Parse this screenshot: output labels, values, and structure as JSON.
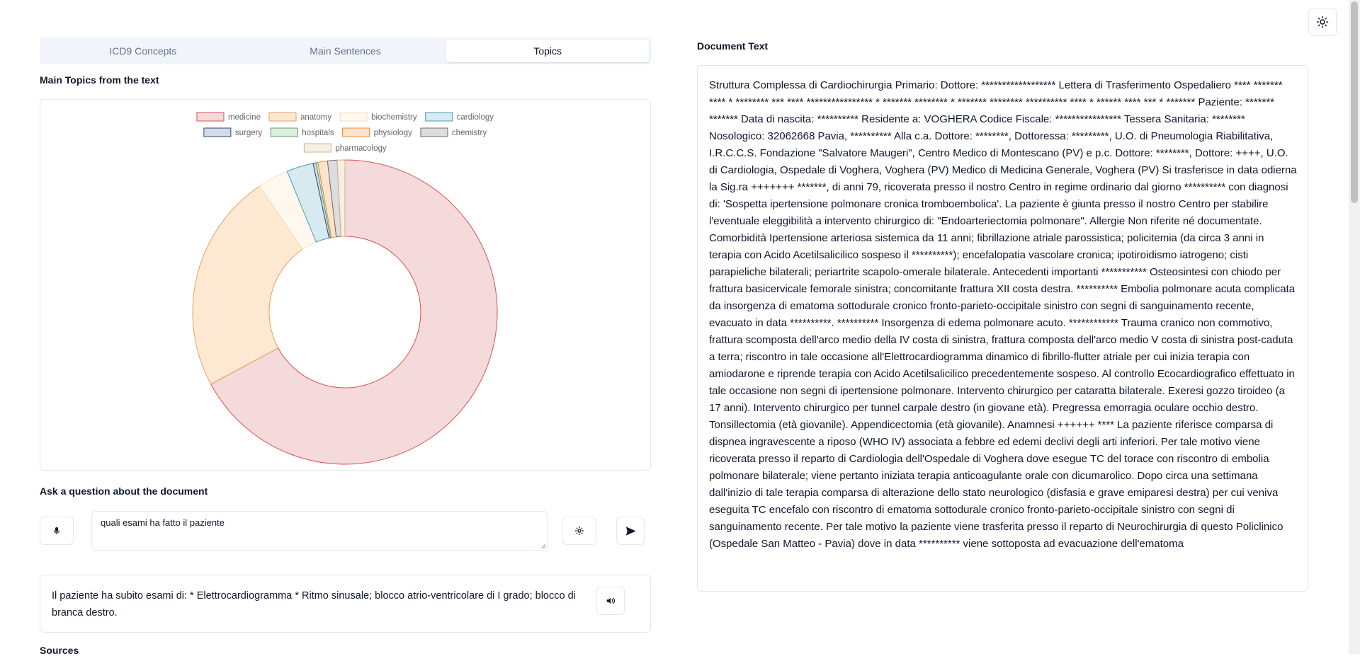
{
  "tabs": [
    {
      "label": "ICD9 Concepts",
      "active": false
    },
    {
      "label": "Main Sentences",
      "active": false
    },
    {
      "label": "Topics",
      "active": true
    }
  ],
  "topics_section": {
    "title": "Main Topics from the text"
  },
  "chart_data": {
    "type": "pie",
    "donut": true,
    "legend_position": "top",
    "series": [
      {
        "name": "medicine",
        "value": 66.0,
        "fill": "#f4dadb",
        "stroke": "#d9534f"
      },
      {
        "name": "anatomy",
        "value": 23.0,
        "fill": "#fde9d2",
        "stroke": "#e8a05c"
      },
      {
        "name": "biochemistry",
        "value": 3.2,
        "fill": "#fff8ee",
        "stroke": "#f3e0c8"
      },
      {
        "name": "cardiology",
        "value": 2.8,
        "fill": "#d6eaf0",
        "stroke": "#4a9db5"
      },
      {
        "name": "surgery",
        "value": 0.3,
        "fill": "#d5dbe6",
        "stroke": "#2c4a78"
      },
      {
        "name": "hospitals",
        "value": 0.2,
        "fill": "#dceee0",
        "stroke": "#5ba06a"
      },
      {
        "name": "physiology",
        "value": 1.0,
        "fill": "#fde3cb",
        "stroke": "#f08a3a"
      },
      {
        "name": "chemistry",
        "value": 1.0,
        "fill": "#dddddd",
        "stroke": "#6d6d6d"
      },
      {
        "name": "pharmacology",
        "value": 0.8,
        "fill": "#f6efe4",
        "stroke": "#c9b48e"
      }
    ]
  },
  "question_section": {
    "title": "Ask a question about the document",
    "question_value": "quali esami ha fatto il paziente"
  },
  "answer": {
    "text": "Il paziente ha subito esami di: * Elettrocardiogramma * Ritmo sinusale; blocco atrio-ventricolare di I grado; blocco di branca destro."
  },
  "sources": {
    "title": "Sources"
  },
  "document": {
    "title": "Document Text",
    "text": "Struttura Complessa di Cardiochirurgia Primario: Dottore: ****************** Lettera di Trasferimento Ospedaliero **** ******* **** * ******** *** **** **************** * ******* ******** * ******* ******** ********** **** * ****** **** *** * ******* Paziente: ******* ******* Data di nascita: ********** Residente a: VOGHERA Codice Fiscale: **************** Tessera Sanitaria: ******** Nosologico: 32062668 Pavia, ********** Alla c.a. Dottore: ********, Dottoressa: *********, U.O. di Pneumologia Riabilitativa, I.R.C.C.S. Fondazione \"Salvatore Maugeri\", Centro Medico di Montescano (PV) e p.c. Dottore: ********, Dottore: ++++, U.O. di Cardiologia, Ospedale di Voghera, Voghera (PV) Medico di Medicina Generale, Voghera (PV) Si trasferisce in data odierna la Sig.ra +++++++ *******, di anni 79, ricoverata presso il nostro Centro in regime ordinario dal giorno ********** con diagnosi di: 'Sospetta ipertensione polmonare cronica tromboembolica'. La paziente è giunta presso il nostro Centro per stabilire l'eventuale eleggibilità a intervento chirurgico di: \"Endoarteriectomia polmonare\". Allergie Non riferite né documentate. Comorbidità Ipertensione arteriosa sistemica da 11 anni; fibrillazione atriale parossistica; policitemia (da circa 3 anni in terapia con Acido Acetilsalicilico sospeso il **********); encefalopatia vascolare cronica; ipotiroidismo iatrogeno; cisti parapieliche bilaterali; periartrite scapolo-omerale bilaterale. Antecedenti importanti *********** Osteosintesi con chiodo per frattura basicervicale femorale sinistra; concomitante frattura XII costa destra. ********** Embolia polmonare acuta complicata da insorgenza di ematoma sottodurale cronico fronto-parieto-occipitale sinistro con segni di sanguinamento recente, evacuato in data **********. ********** Insorgenza di edema polmonare acuto. ************ Trauma cranico non commotivo, frattura scomposta dell'arco medio della IV costa di sinistra, frattura composta dell'arco medio V costa di sinistra post-caduta a terra; riscontro in tale occasione all'Elettrocardiogramma dinamico di fibrillo-flutter atriale per cui inizia terapia con amiodarone e riprende terapia con Acido Acetilsalicilico precedentemente sospeso. Al controllo Ecocardiografico effettuato in tale occasione non segni di ipertensione polmonare. Intervento chirurgico per cataratta bilaterale. Exeresi gozzo tiroideo (a 17 anni). Intervento chirurgico per tunnel carpale destro (in giovane età). Pregressa emorragia oculare occhio destro. Tonsillectomia (età giovanile). Appendicectomia (età giovanile). Anamnesi ++++++ **** La paziente riferisce comparsa di dispnea ingravescente a riposo (WHO IV) associata a febbre ed edemi declivi degli arti inferiori. Per tale motivo viene ricoverata presso il reparto di Cardiologia dell'Ospedale di Voghera dove esegue TC del torace con riscontro di embolia polmonare bilaterale; viene pertanto iniziata terapia anticoagulante orale con dicumarolico. Dopo circa una settimana dall'inizio di tale terapia comparsa di alterazione dello stato neurologico (disfasia e grave emiparesi destra) per cui veniva eseguita TC encefalo con riscontro di ematoma sottodurale cronico fronto-parieto-occipitale sinistro con segni di sanguinamento recente. Per tale motivo la paziente viene trasferita presso il reparto di Neurochirurgia di questo Policlinico (Ospedale San Matteo - Pavia) dove in data ********** viene sottoposta ad evacuazione dell'ematoma"
  },
  "icons": {
    "theme": "sun-icon",
    "mic": "microphone-icon",
    "settings": "gear-icon",
    "send": "send-icon",
    "speaker": "speaker-icon"
  }
}
